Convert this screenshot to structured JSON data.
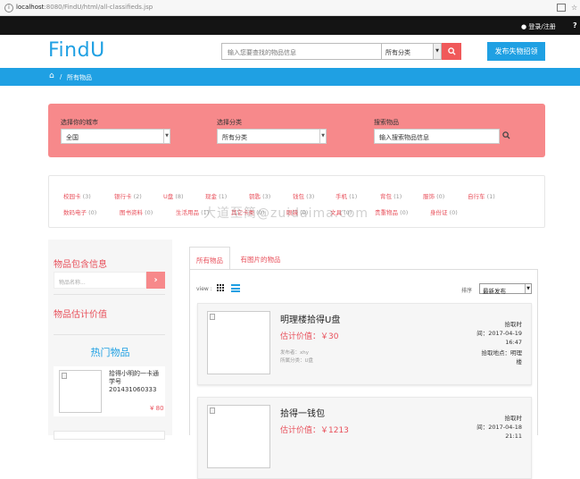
{
  "browser": {
    "url_host": "localhost",
    "url_path": ":8080/FindU/html/all-classifieds.jsp"
  },
  "topbar": {
    "login": "登录/注册",
    "help": "?"
  },
  "header": {
    "logo": "FindU",
    "search_placeholder": "输入您要查找的物品信息",
    "category": "所有分类",
    "post_button": "发布失物招领"
  },
  "breadcrumb": {
    "current": "所有物品"
  },
  "filter": {
    "city_label": "选择你的城市",
    "city_value": "全国",
    "category_label": "选择分类",
    "category_value": "所有分类",
    "search_label": "搜索物品",
    "search_value": "输入搜索物品信息"
  },
  "tags": [
    {
      "name": "校园卡",
      "count": "(3)"
    },
    {
      "name": "银行卡",
      "count": "(2)"
    },
    {
      "name": "U盘",
      "count": "(8)"
    },
    {
      "name": "现金",
      "count": "(1)"
    },
    {
      "name": "钥匙",
      "count": "(3)"
    },
    {
      "name": "钱包",
      "count": "(3)"
    },
    {
      "name": "手机",
      "count": "(1)"
    },
    {
      "name": "背包",
      "count": "(1)"
    },
    {
      "name": "服饰",
      "count": "(0)"
    },
    {
      "name": "自行车",
      "count": "(1)"
    },
    {
      "name": "数码电子",
      "count": "(0)"
    },
    {
      "name": "图书资料",
      "count": "(0)"
    },
    {
      "name": "生活用品",
      "count": "(1)"
    },
    {
      "name": "其它卡类",
      "count": "(0)"
    },
    {
      "name": "眼镜",
      "count": "(0)"
    },
    {
      "name": "文具",
      "count": "(0)"
    },
    {
      "name": "贵重物品",
      "count": "(0)"
    },
    {
      "name": "身份证",
      "count": "(0)"
    }
  ],
  "watermark": "大道至简@zuidaima.com",
  "sidebar": {
    "contains_title": "物品包含信息",
    "name_placeholder": "物品名称...",
    "value_title": "物品估计价值",
    "hot_title": "热门物品",
    "hot_item": {
      "title": "拾得小明的一卡通 学号201431060333",
      "price": "¥ 80"
    }
  },
  "tabs": {
    "all": "所有物品",
    "with_images": "有图片的物品"
  },
  "toolbar": {
    "view_label": "view :",
    "sort_label": "排序",
    "sort_value": "最新发布"
  },
  "items": [
    {
      "title": "明理楼拾得U盘",
      "price": "估计价值：￥30",
      "publisher": "发布者：xhy",
      "category": "所属分类：U盘",
      "time_label": "拾取时",
      "time_value": "间：2017-04-19",
      "time_clock": "16:47",
      "place_label": "拾取地点：明理",
      "place_value": "楼"
    },
    {
      "title": "拾得一钱包",
      "price": "估计价值：￥1213",
      "publisher": "",
      "category": "",
      "time_label": "拾取时",
      "time_value": "间：2017-04-18",
      "time_clock": "21:11",
      "place_label": "",
      "place_value": ""
    }
  ]
}
